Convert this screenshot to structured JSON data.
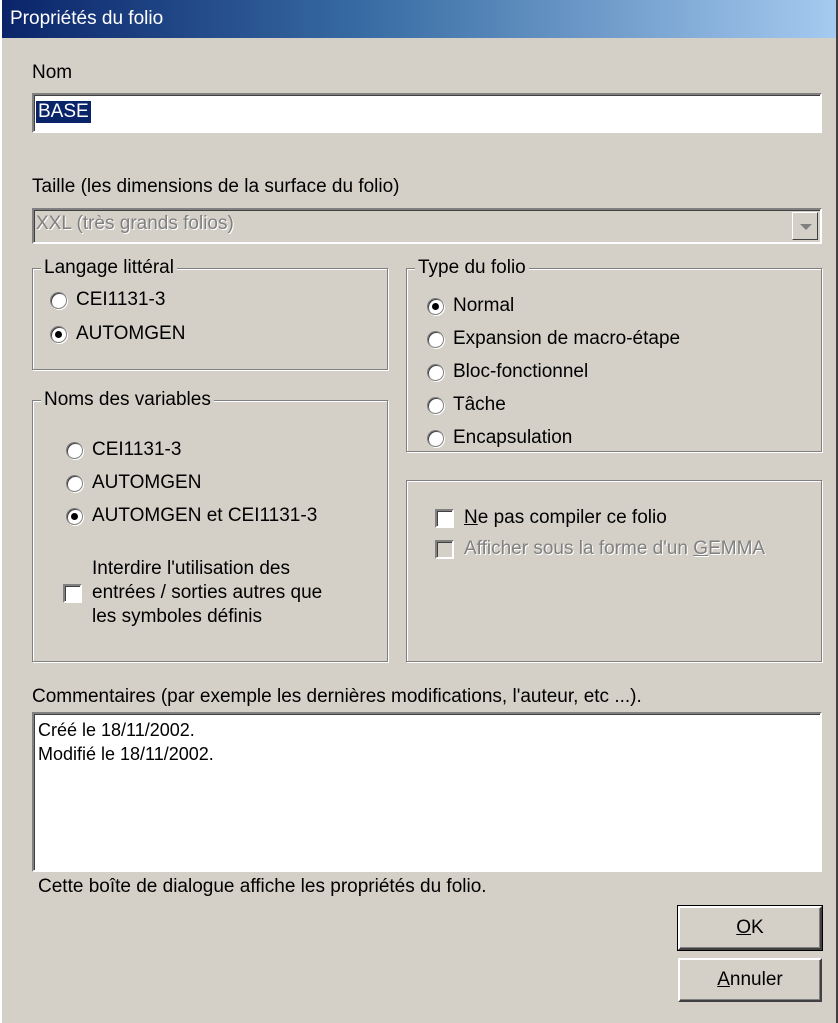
{
  "window": {
    "title": "Propriétés du folio"
  },
  "name": {
    "label": "Nom",
    "value": "BASE"
  },
  "size": {
    "label": "Taille (les dimensions de la surface du folio)",
    "value": "XXL (très grands folios)"
  },
  "literal_language": {
    "title": "Langage littéral",
    "options": [
      {
        "label": "CEI1131-3",
        "checked": false
      },
      {
        "label": "AUTOMGEN",
        "checked": true
      }
    ]
  },
  "folio_type": {
    "title": "Type du folio",
    "options": [
      {
        "label": "Normal",
        "checked": true
      },
      {
        "label": "Expansion de macro-étape",
        "checked": false
      },
      {
        "label": "Bloc-fonctionnel",
        "checked": false
      },
      {
        "label": "Tâche",
        "checked": false
      },
      {
        "label": "Encapsulation",
        "checked": false
      }
    ]
  },
  "variable_names": {
    "title": "Noms des variables",
    "options": [
      {
        "label": "CEI1131-3",
        "checked": false
      },
      {
        "label": "AUTOMGEN",
        "checked": false
      },
      {
        "label": "AUTOMGEN et CEI1131-3",
        "checked": true
      }
    ],
    "restrict": {
      "line1": "Interdire l'utilisation des",
      "line2": "entrées / sorties autres que",
      "line3": "les symboles définis",
      "checked": false
    }
  },
  "options": {
    "no_compile": {
      "mnemonic": "N",
      "rest": "e pas compiler ce folio",
      "checked": false
    },
    "gemma": {
      "pre": "Afficher sous la forme d'un ",
      "mnemonic": "G",
      "post": "EMMA",
      "checked": false,
      "enabled": false
    }
  },
  "comments": {
    "label": "Commentaires (par exemple les dernières modifications, l'auteur, etc ...).",
    "lines": [
      "Créé le 18/11/2002.",
      "Modifié le 18/11/2002."
    ]
  },
  "status_text": "Cette boîte de dialogue affiche les propriétés du folio.",
  "buttons": {
    "ok": {
      "mnemonic": "O",
      "rest": "K"
    },
    "cancel": {
      "mnemonic": "A",
      "rest": "nnuler"
    }
  },
  "colors": {
    "face": "#d4d0c8",
    "title_start": "#0a246a",
    "title_end": "#a6caf0",
    "selection": "#0a246a"
  }
}
